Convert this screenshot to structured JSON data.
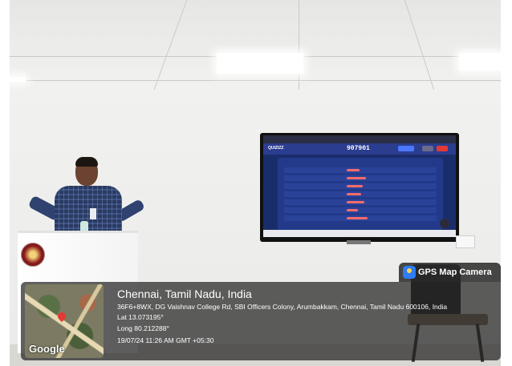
{
  "photo": {
    "screen": {
      "brand": "QUIZIZZ",
      "join_code": "907901"
    },
    "geotag": {
      "app_name": "GPS Map Camera",
      "map_provider": "Google",
      "place": "Chennai, Tamil Nadu, India",
      "address": "36F6+8WX, DG Vaishnav College Rd, SBI Officers Colony, Arumbakkam, Chennai, Tamil Nadu 600106, India",
      "latitude": "Lat 13.073195°",
      "longitude": "Long 80.212288°",
      "datetime": "19/07/24 11:26 AM GMT +05:30"
    }
  }
}
